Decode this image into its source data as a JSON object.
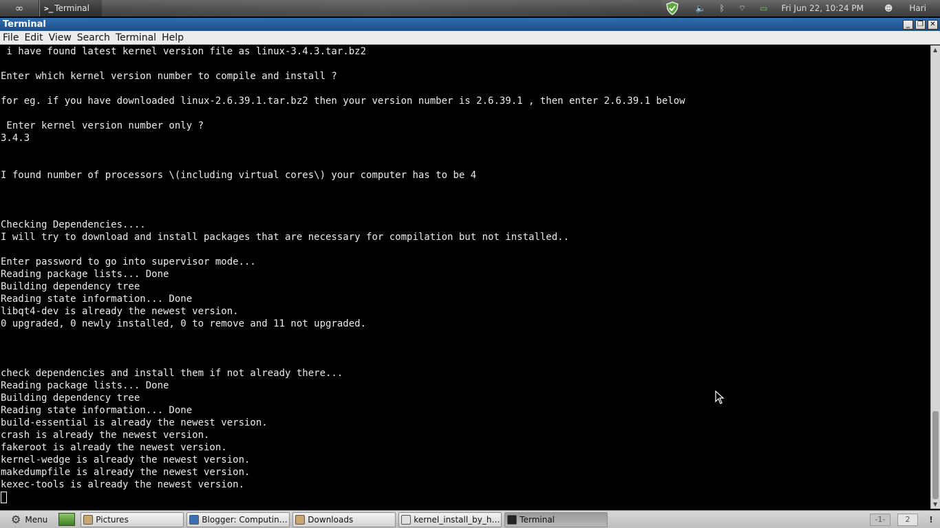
{
  "top_panel": {
    "task_label": "Terminal",
    "task_icon_text": ">_",
    "clock": "Fri Jun 22, 10:24 PM",
    "user": "Hari"
  },
  "window": {
    "title": "Terminal",
    "menu": [
      "File",
      "Edit",
      "View",
      "Search",
      "Terminal",
      "Help"
    ],
    "controls": [
      "minimize",
      "maximize",
      "close"
    ]
  },
  "terminal": {
    "lines": [
      " i have found latest kernel version file as linux-3.4.3.tar.bz2",
      "",
      "Enter which kernel version number to compile and install ?",
      "",
      "for eg. if you have downloaded linux-2.6.39.1.tar.bz2 then your version number is 2.6.39.1 , then enter 2.6.39.1 below",
      "",
      " Enter kernel version number only ?",
      "3.4.3",
      "",
      "",
      "I found number of processors \\(including virtual cores\\) your computer has to be 4",
      "",
      "",
      "",
      "Checking Dependencies....",
      "I will try to download and install packages that are necessary for compilation but not installed..",
      "",
      "Enter password to go into supervisor mode...",
      "Reading package lists... Done",
      "Building dependency tree",
      "Reading state information... Done",
      "libqt4-dev is already the newest version.",
      "0 upgraded, 0 newly installed, 0 to remove and 11 not upgraded.",
      "",
      "",
      "",
      "check dependencies and install them if not already there...",
      "Reading package lists... Done",
      "Building dependency tree",
      "Reading state information... Done",
      "build-essential is already the newest version.",
      "crash is already the newest version.",
      "fakeroot is already the newest version.",
      "kernel-wedge is already the newest version.",
      "makedumpfile is already the newest version.",
      "kexec-tools is already the newest version."
    ]
  },
  "bottom_panel": {
    "menu_label": "Menu",
    "tasks": [
      {
        "label": "Pictures",
        "icon": "folder-icon",
        "color": "#c9a66b",
        "active": false
      },
      {
        "label": "Blogger: Computing ...",
        "icon": "browser-icon",
        "color": "#3a6fb5",
        "active": false
      },
      {
        "label": "Downloads",
        "icon": "folder-icon",
        "color": "#c9a66b",
        "active": false
      },
      {
        "label": "kernel_install_by_ha...",
        "icon": "text-file-icon",
        "color": "#e0e0e0",
        "active": false
      },
      {
        "label": "Terminal",
        "icon": "terminal-icon",
        "color": "#222222",
        "active": true
      }
    ],
    "workspaces": [
      "-1-",
      "2"
    ],
    "notification": "!"
  }
}
